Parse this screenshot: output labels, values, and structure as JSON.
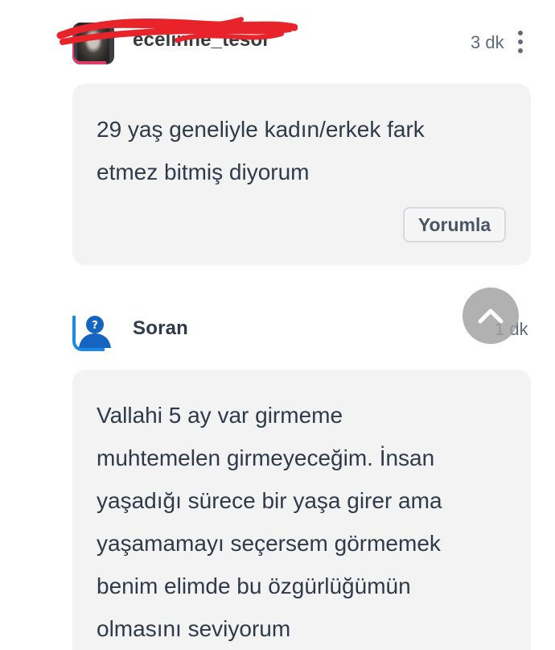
{
  "comments": [
    {
      "username": "ecelinne_tesor",
      "time": "3 dk",
      "text_lines": [
        "29 yaş geneliyle kadın/erkek fark",
        "etmez bitmiş diyorum"
      ],
      "reply_label": "Yorumla"
    },
    {
      "username": "Soran",
      "time": "1 dk",
      "text_lines": [
        "Vallahi 5 ay var girmeme",
        "muhtemelen girmeyeceğim. İnsan",
        "yaşadığı sürece bir yaşa girer ama",
        "yaşamamayı seçersem görmemek",
        "benim elimde bu özgürlüğümün",
        "olmasını seviyorum"
      ]
    }
  ],
  "icons": {
    "avatar_anon": "anonymous-user-icon",
    "menu": "more-vertical-icon",
    "scroll_top": "chevron-up-icon"
  },
  "colors": {
    "bubble_bg": "#f3f3f4",
    "text": "#2f3a4a",
    "redaction": "#e8232a",
    "anon_accent": "#1e88e5"
  }
}
